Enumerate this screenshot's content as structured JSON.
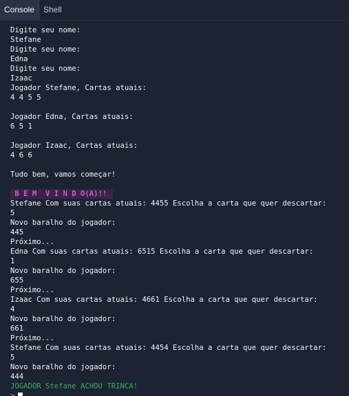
{
  "tabs": [
    {
      "label": "Console"
    },
    {
      "label": "Shell"
    }
  ],
  "console": {
    "lines": [
      {
        "text": "Digite seu nome:",
        "kind": "normal"
      },
      {
        "text": "Stefane",
        "kind": "normal"
      },
      {
        "text": "Digite seu nome:",
        "kind": "normal"
      },
      {
        "text": "Edna",
        "kind": "normal"
      },
      {
        "text": "Digite seu nome:",
        "kind": "normal"
      },
      {
        "text": "Izaac",
        "kind": "normal"
      },
      {
        "text": "Jogador Stefane, Cartas atuais:",
        "kind": "normal"
      },
      {
        "text": "4 4 5 5",
        "kind": "normal"
      },
      {
        "text": "",
        "kind": "normal"
      },
      {
        "text": "Jogador Edna, Cartas atuais:",
        "kind": "normal"
      },
      {
        "text": "6 5 1",
        "kind": "normal"
      },
      {
        "text": "",
        "kind": "normal"
      },
      {
        "text": "Jogador Izaac, Cartas atuais:",
        "kind": "normal"
      },
      {
        "text": "4 6 6",
        "kind": "normal"
      },
      {
        "text": "",
        "kind": "normal"
      },
      {
        "text": "Tudo bem, vamos começar!",
        "kind": "normal"
      },
      {
        "text": "",
        "kind": "normal"
      },
      {
        "text": " B E M  V I N D O(A)!! ",
        "kind": "banner"
      },
      {
        "text": "Stefane Com suas cartas atuais: 4455 Escolha a carta que quer descartar:",
        "kind": "normal"
      },
      {
        "text": "5",
        "kind": "normal"
      },
      {
        "text": "Novo baralho do jogador:",
        "kind": "normal"
      },
      {
        "text": "445",
        "kind": "normal"
      },
      {
        "text": "Próximo...",
        "kind": "normal"
      },
      {
        "text": "Edna Com suas cartas atuais: 6515 Escolha a carta que quer descartar:",
        "kind": "normal"
      },
      {
        "text": "1",
        "kind": "normal"
      },
      {
        "text": "Novo baralho do jogador:",
        "kind": "normal"
      },
      {
        "text": "655",
        "kind": "normal"
      },
      {
        "text": "Próximo...",
        "kind": "normal"
      },
      {
        "text": "Izaac Com suas cartas atuais: 4661 Escolha a carta que quer descartar:",
        "kind": "normal"
      },
      {
        "text": "4",
        "kind": "normal"
      },
      {
        "text": "Novo baralho do jogador:",
        "kind": "normal"
      },
      {
        "text": "661",
        "kind": "normal"
      },
      {
        "text": "Próximo...",
        "kind": "normal"
      },
      {
        "text": "Stefane Com suas cartas atuais: 4454 Escolha a carta que quer descartar:",
        "kind": "normal"
      },
      {
        "text": "5",
        "kind": "normal"
      },
      {
        "text": "Novo baralho do jogador:",
        "kind": "normal"
      },
      {
        "text": "444",
        "kind": "normal"
      },
      {
        "text": "JOGADOR Stefane ACHOU TRINCA!",
        "kind": "success"
      }
    ],
    "prompt_symbol": ">"
  }
}
